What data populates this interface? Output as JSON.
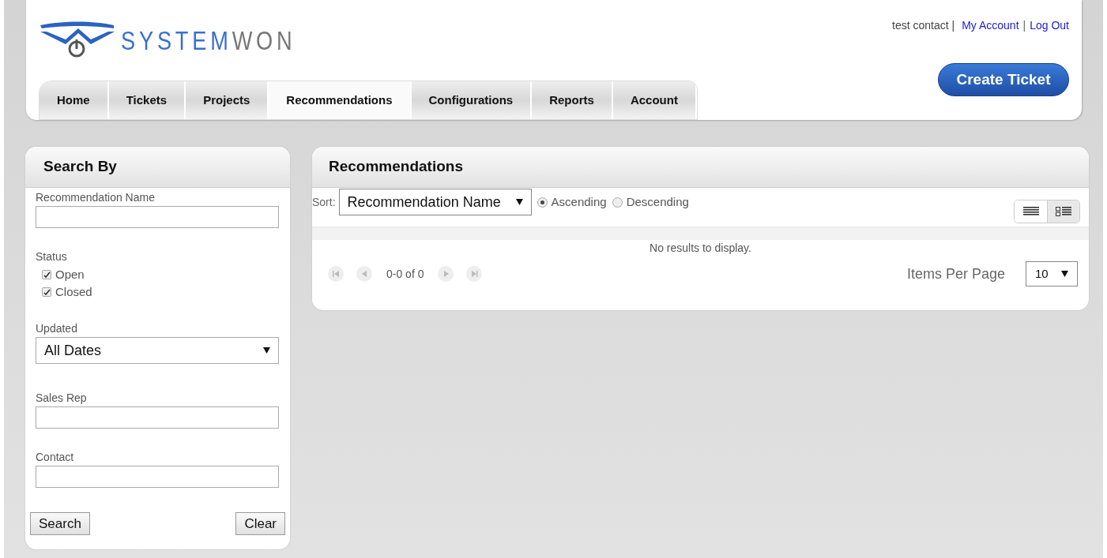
{
  "logo": {
    "part_1": "SYSTEM",
    "part_2": "WON"
  },
  "user_bar": {
    "user": "test contact |",
    "links": [
      "My Account",
      "Log Out"
    ],
    "separator": "|"
  },
  "tabs": [
    {
      "label": "Home",
      "selected": false
    },
    {
      "label": "Tickets",
      "selected": false
    },
    {
      "label": "Projects",
      "selected": false
    },
    {
      "label": "Recommendations",
      "selected": true
    },
    {
      "label": "Configurations",
      "selected": false
    },
    {
      "label": "Reports",
      "selected": false
    },
    {
      "label": "Account",
      "selected": false
    }
  ],
  "create_button": "Create Ticket",
  "search_panel": {
    "title": "Search By",
    "name_label": "Recommendation Name",
    "status_label": "Status",
    "statuses": [
      {
        "label": "Open",
        "checked": true
      },
      {
        "label": "Closed",
        "checked": true
      }
    ],
    "updated_label": "Updated",
    "updated_value": "All Dates",
    "sales_rep_label": "Sales Rep",
    "contact_label": "Contact",
    "buttons": [
      "Search",
      "Clear"
    ]
  },
  "results_panel": {
    "title": "Recommendations",
    "sort_label": "Sort:",
    "sort_value": "Recommendation Name",
    "order": [
      {
        "label": "Ascending",
        "selected": true
      },
      {
        "label": "Descending",
        "selected": false
      }
    ],
    "views": [
      {
        "kind": "list",
        "selected": false
      },
      {
        "kind": "detail",
        "selected": true
      }
    ],
    "empty_message": "No results to display.",
    "range": "0-0 of 0",
    "per_page_label": "Items Per Page",
    "per_page_value": "10"
  }
}
